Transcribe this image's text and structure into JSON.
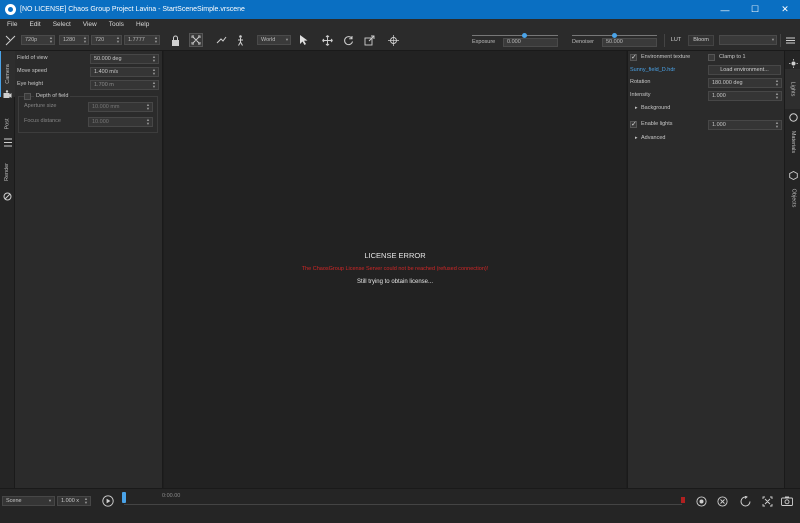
{
  "window": {
    "title": "[NO LICENSE] Chaos Group Project Lavina - StartSceneSimple.vrscene",
    "minimize": "—",
    "maximize": "☐",
    "close": "✕"
  },
  "menu": [
    "File",
    "Edit",
    "Select",
    "View",
    "Tools",
    "Help"
  ],
  "toolbar": {
    "preset": "720p",
    "width": "1280",
    "height": "720",
    "aspect": "1.7777",
    "space": "World",
    "exposure_label": "Exposure",
    "exposure_value": "0.000",
    "exposure_level": 0.61,
    "denoiser_label": "Denoiser",
    "denoiser_value": "50.000",
    "denoiser_level": 0.5,
    "lut_label": "LUT",
    "bloom_label": "Bloom",
    "extra_dropdown": ""
  },
  "left_tabs": [
    "Camera",
    "Post",
    "Render"
  ],
  "camera": {
    "field_of_view_label": "Field of view",
    "field_of_view_value": "50.000 deg",
    "move_speed_label": "Move speed",
    "move_speed_value": "1.400 m/s",
    "eye_height_label": "Eye height",
    "eye_height_value": "1.700 m",
    "dof_label": "Depth of field",
    "aperture_label": "Aperture size",
    "aperture_value": "10.000 mm",
    "focus_label": "Focus distance",
    "focus_value": "10.000"
  },
  "viewport": {
    "error_title": "LICENSE ERROR",
    "error_message": "The ChaosGroup License Server could not be reached (refused connection)!",
    "status": "Still trying to obtain license..."
  },
  "lights": {
    "env_texture_label": "Environment texture",
    "clamp_label": "Clamp to 1",
    "file_name": "Sunny_field_D.hdr",
    "load_button": "Load environment...",
    "rotation_label": "Rotation",
    "rotation_value": "180.000 deg",
    "intensity_label": "Intensity",
    "intensity_value": "1.000",
    "background_label": "Background",
    "enable_lights_label": "Enable lights",
    "enable_lights_value": "1.000",
    "advanced_label": "Advanced"
  },
  "right_tabs": [
    "Lights",
    "Materials",
    "Objects"
  ],
  "bottom": {
    "scene_select": "Scene",
    "speed": "1.000 x",
    "time": "0:00.00"
  },
  "colors": {
    "accent": "#0a6fc2",
    "error": "#d12626",
    "slider": "#4aa3e8"
  }
}
